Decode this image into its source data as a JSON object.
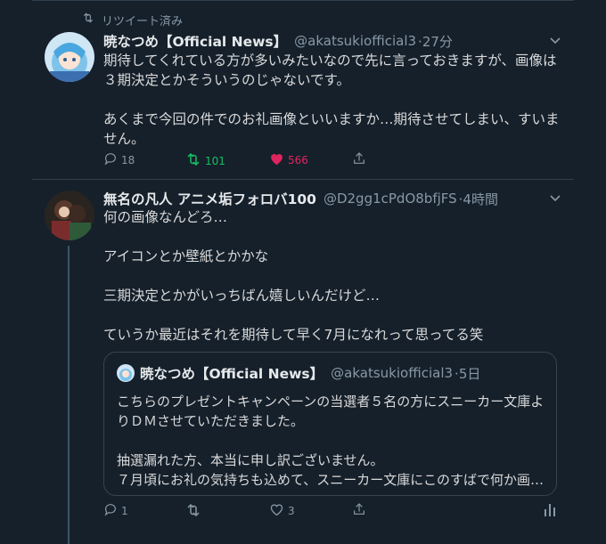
{
  "tweet1": {
    "retweet_label": "リツイート済み",
    "name": "暁なつめ【Official News】",
    "handle": "@akatsukiofficial3",
    "time": "·27分",
    "body": "期待してくれている方が多いみたいなので先に言っておきますが、画像は３期決定とかそういうのじゃないです。\n\nあくまで今回の件でのお礼画像といいますか…期待させてしまい、すいません。",
    "replies": "18",
    "retweets": "101",
    "likes": "566"
  },
  "tweet2": {
    "name": "無名の凡人 アニメ垢フォロバ100",
    "handle": "@D2gg1cPdO8bfjFS",
    "time": "·4時間",
    "body": "何の画像なんどろ…\n\nアイコンとか壁紙とかかな\n\n三期決定とかがいっちばん嬉しいんだけど…\n\nていうか最近はそれを期待して早く7月になれって思ってる笑",
    "quote": {
      "name": "暁なつめ【Official News】",
      "handle": "@akatsukiofficial3",
      "time": "·5日",
      "body": "こちらのプレゼントキャンペーンの当選者５名の方にスニーカー文庫よりＤＭさせていただきました。\n\n抽選漏れた方、本当に申し訳ございません。\n７月頃にお礼の気持ちも込めて、スニーカー文庫にこのすばで何か画…"
    },
    "replies": "1",
    "retweets": "",
    "likes": "3"
  },
  "colors": {
    "background": "#15202b",
    "retweet_green": "#17bf63",
    "like_pink": "#e0245e",
    "muted": "#8899a6"
  }
}
